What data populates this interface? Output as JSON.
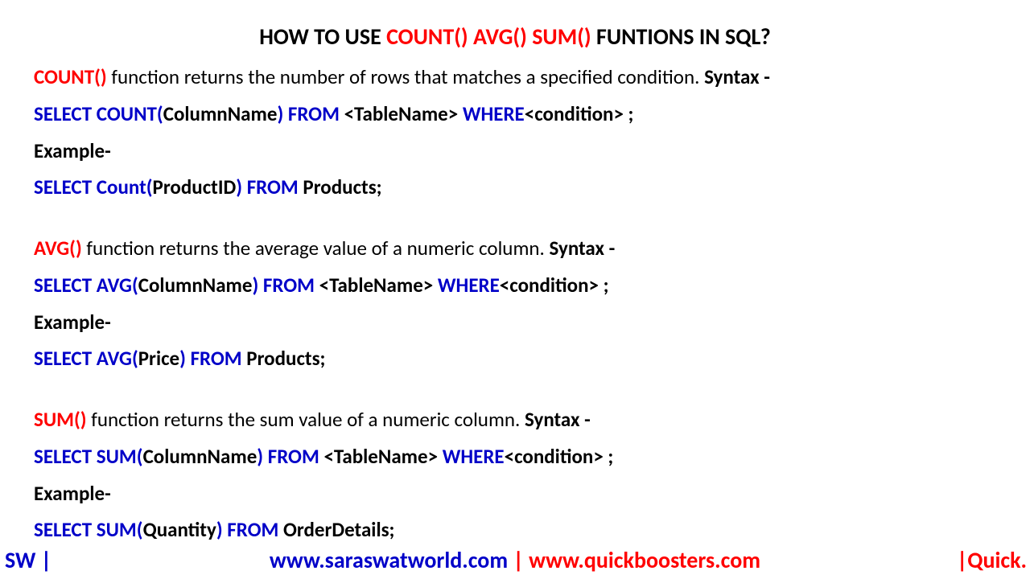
{
  "title": {
    "pre": "HOW TO USE ",
    "funcs": "COUNT() AVG() SUM()",
    "post": " FUNTIONS IN SQL?"
  },
  "count": {
    "name": "COUNT()",
    "desc": " function returns the number of rows that matches a specified condition. ",
    "syntaxLabel": "Syntax -",
    "syntax": {
      "select": "SELECT  COUNT(",
      "col": "ColumnName",
      "mid": ")  FROM ",
      "tbl": "<TableName> ",
      "where": "WHERE",
      "cond": "<condition>  ;"
    },
    "exampleLabel": "Example-",
    "example": {
      "select": "SELECT  Count(",
      "col": "ProductID",
      "mid": ") FROM ",
      "tbl": "Products;"
    }
  },
  "avg": {
    "name": "AVG()",
    "desc": " function returns the average value of a numeric column. ",
    "syntaxLabel": "Syntax -",
    "syntax": {
      "select": "SELECT  AVG(",
      "col": "ColumnName",
      "mid": ")  FROM ",
      "tbl": "<TableName> ",
      "where": "WHERE",
      "cond": "<condition>  ;"
    },
    "exampleLabel": "Example-",
    "example": {
      "select": "SELECT  AVG(",
      "col": "Price",
      "mid": ") FROM ",
      "tbl": "Products;"
    }
  },
  "sum": {
    "name": "SUM()",
    "desc": " function returns the sum value of a numeric column. ",
    "syntaxLabel": "Syntax -",
    "syntax": {
      "select": "SELECT  SUM(",
      "col": "ColumnName",
      "mid": ")  FROM ",
      "tbl": "<TableName> ",
      "where": "WHERE",
      "cond": "<condition>  ;"
    },
    "exampleLabel": "Example-",
    "example": {
      "select": "SELECT  SUM(",
      "col": "Quantity",
      "mid": ") FROM ",
      "tbl": "OrderDetails;"
    }
  },
  "footer": {
    "left": "SW |",
    "url1": "www.saraswatworld.com",
    "sep": " | ",
    "url2": "www.quickboosters.com",
    "right": "|Quick."
  }
}
